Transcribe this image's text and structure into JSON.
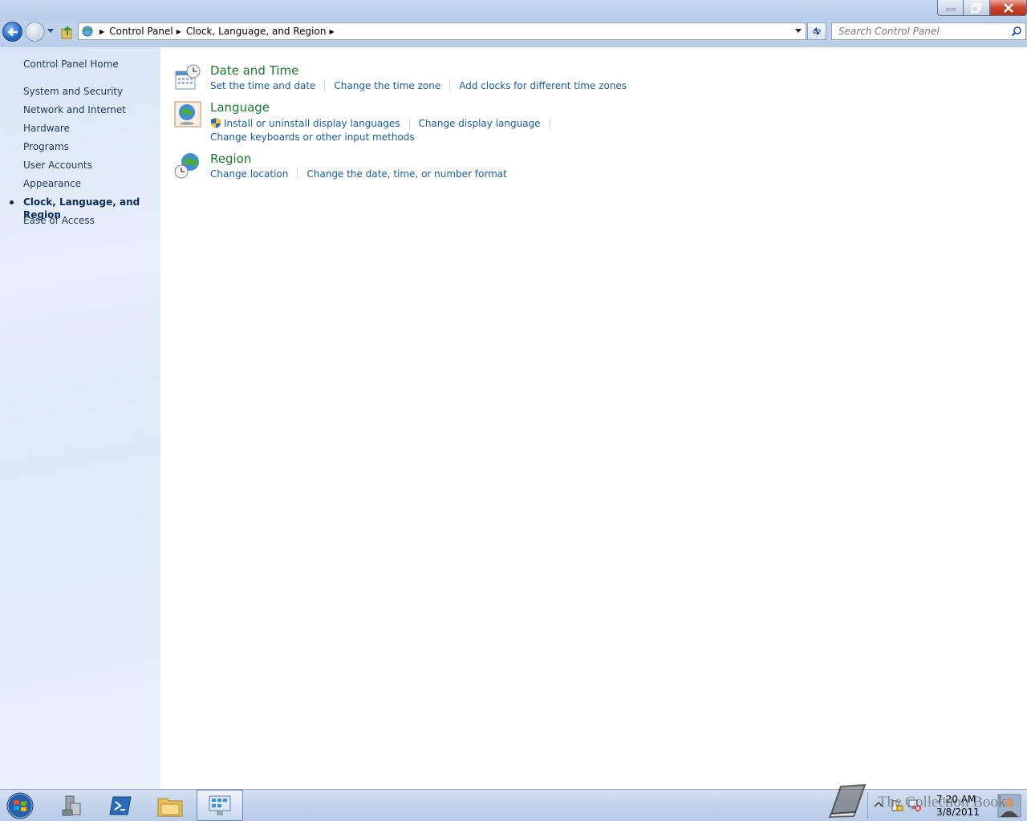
{
  "navigation": {
    "breadcrumbs": [
      "Control Panel",
      "Clock, Language, and Region"
    ],
    "search_placeholder": "Search Control Panel"
  },
  "sidebar": {
    "home_label": "Control Panel Home",
    "items": [
      {
        "label": "System and Security",
        "active": false
      },
      {
        "label": "Network and Internet",
        "active": false
      },
      {
        "label": "Hardware",
        "active": false
      },
      {
        "label": "Programs",
        "active": false
      },
      {
        "label": "User Accounts",
        "active": false
      },
      {
        "label": "Appearance",
        "active": false
      },
      {
        "label": "Clock, Language, and Region",
        "active": true
      },
      {
        "label": "Ease of Access",
        "active": false
      }
    ]
  },
  "categories": [
    {
      "title": "Date and Time",
      "icon": "calendar-clock-icon",
      "links": [
        "Set the time and date",
        "Change the time zone",
        "Add clocks for different time zones"
      ]
    },
    {
      "title": "Language",
      "icon": "globe-monitor-icon",
      "links": [
        "Install or uninstall display languages",
        "Change display language"
      ],
      "links2": [
        "Change keyboards or other input methods"
      ]
    },
    {
      "title": "Region",
      "icon": "globe-clock-icon",
      "links": [
        "Change location",
        "Change the date, time, or number format"
      ]
    }
  ],
  "taskbar": {
    "items": [
      "server-manager-icon",
      "powershell-icon",
      "file-explorer-icon",
      "control-panel-icon"
    ],
    "clock_time": "7:20 AM",
    "clock_date": "3/8/2011"
  },
  "watermark": "The Collection Book",
  "colors": {
    "category_title": "#1a7a2a",
    "link": "#1a5ba6",
    "sidebar_text": "#1e395b"
  }
}
